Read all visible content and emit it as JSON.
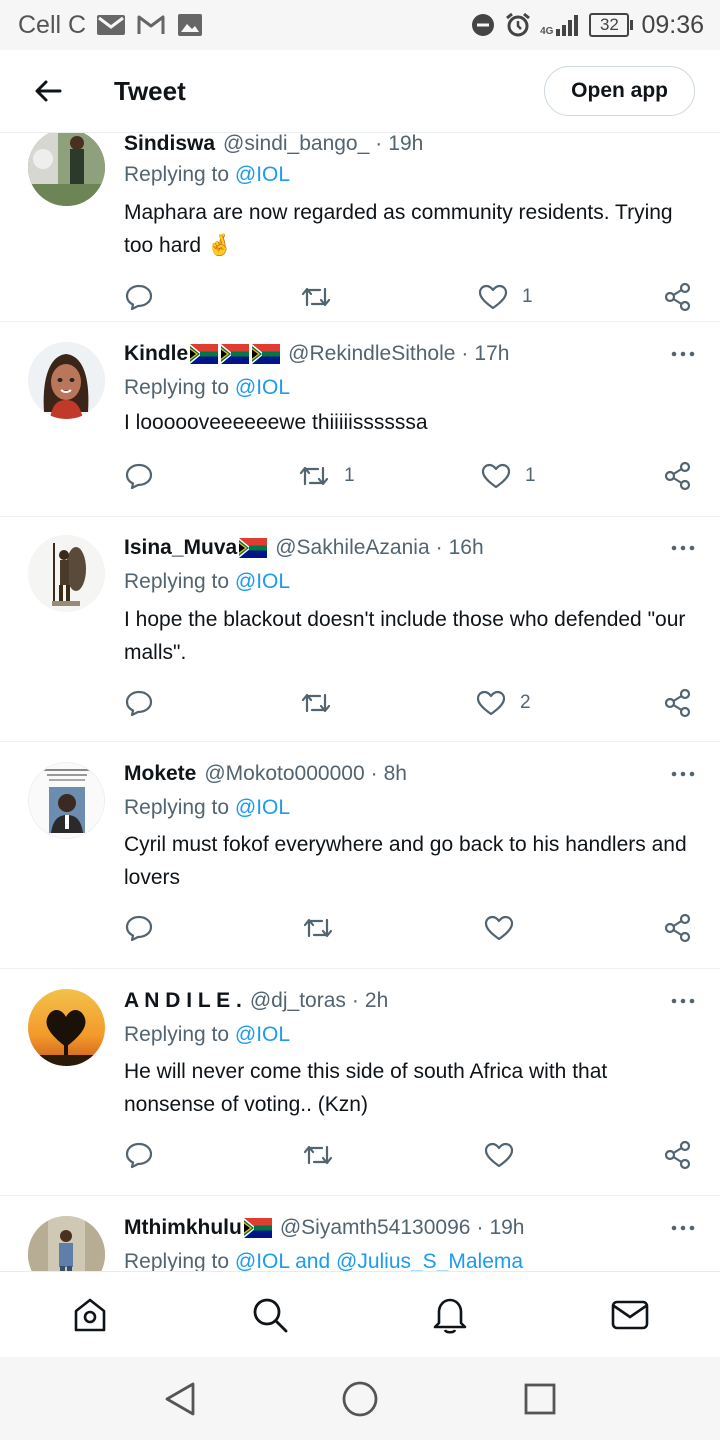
{
  "status_bar": {
    "carrier": "Cell C",
    "network": "4G",
    "battery": "32",
    "time": "09:36"
  },
  "app_bar": {
    "title": "Tweet",
    "open_app_label": "Open app"
  },
  "replying_label": "Replying to",
  "tweets": [
    {
      "name": "Sindiswa",
      "handle": "@sindi_bango_",
      "time": "19h",
      "replying_to": "@IOL",
      "text": "Maphara are now regarded as community residents. Trying too hard 🤞",
      "replies": "",
      "retweets": "",
      "likes": "1"
    },
    {
      "name": "Kindle",
      "handle": "@RekindleSithole",
      "time": "17h",
      "replying_to": "@IOL",
      "text": "I loooooveeeeeewe thiiiiissssssa",
      "replies": "",
      "retweets": "1",
      "likes": "1"
    },
    {
      "name": "Isina_Muva",
      "handle": "@SakhileAzania",
      "time": "16h",
      "replying_to": "@IOL",
      "text": "I hope the blackout doesn't include those who defended \"our malls\".",
      "replies": "",
      "retweets": "",
      "likes": "2"
    },
    {
      "name": "Mokete",
      "handle": "@Mokoto000000",
      "time": "8h",
      "replying_to": "@IOL",
      "text": "Cyril must fokof everywhere and go back to his handlers and lovers",
      "replies": "",
      "retweets": "",
      "likes": ""
    },
    {
      "name": "A N D I L E .",
      "handle": "@dj_toras",
      "time": "2h",
      "replying_to": "@IOL",
      "text": "He will never come this side of south Africa with that nonsense of voting..  (Kzn)",
      "replies": "",
      "retweets": "",
      "likes": ""
    },
    {
      "name": "Mthimkhulu",
      "handle": "@Siyamth54130096",
      "time": "19h",
      "replying_to": "@IOL and @Julius_S_Malema",
      "text": "",
      "replies": "",
      "retweets": "",
      "likes": ""
    }
  ],
  "colors": {
    "accent": "#1d9bf0",
    "secondary_text": "#536471",
    "primary_text": "#0f1419",
    "divider": "#eff3f4"
  },
  "icons": {
    "app_bar": [
      "back-arrow-icon"
    ],
    "tweet_actions": [
      "reply-icon",
      "retweet-icon",
      "like-icon",
      "share-icon",
      "more-icon"
    ],
    "bottom_nav": [
      "home-icon",
      "search-icon",
      "notifications-icon",
      "messages-icon"
    ],
    "system_nav": [
      "back-triangle-icon",
      "home-circle-icon",
      "recents-square-icon"
    ]
  }
}
